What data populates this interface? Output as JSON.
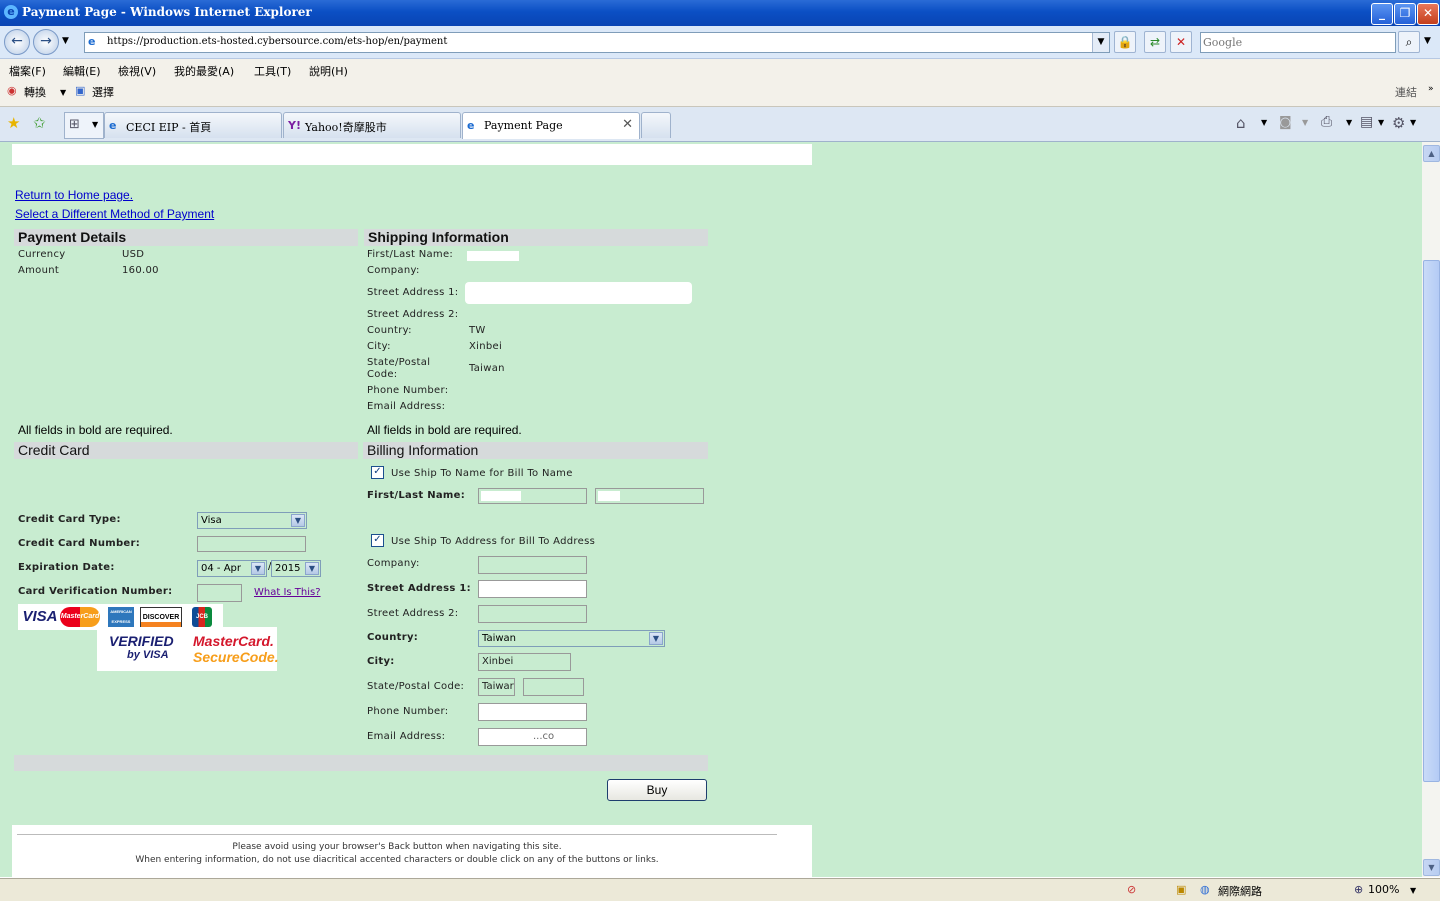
{
  "window": {
    "title": "Payment Page - Windows Internet Explorer"
  },
  "address": {
    "url": "https://production.ets-hosted.cybersource.com/ets-hop/en/payment",
    "search_placeholder": "Google"
  },
  "menu": {
    "file": "檔案(F)",
    "edit": "編輯(E)",
    "view": "檢視(V)",
    "favorites": "我的最愛(A)",
    "tools": "工具(T)",
    "help": "說明(H)"
  },
  "linkbar": {
    "convert": "轉換",
    "select": "選擇",
    "links": "連結"
  },
  "tabs": [
    {
      "label": "CECI EIP - 首頁"
    },
    {
      "label": "Yahoo!奇摩股市"
    },
    {
      "label": "Payment Page"
    }
  ],
  "page": {
    "return_home": "Return to Home page.",
    "different_method": "Select a Different Method of Payment",
    "payment_details": {
      "heading": "Payment Details",
      "currency_label": "Currency",
      "currency_value": "USD",
      "amount_label": "Amount",
      "amount_value": "160.00"
    },
    "shipping": {
      "heading": "Shipping Information",
      "name_label": "First/Last Name:",
      "company_label": "Company:",
      "street1_label": "Street Address 1:",
      "street2_label": "Street Address 2:",
      "country_label": "Country:",
      "country_value": "TW",
      "city_label": "City:",
      "city_value": "Xinbei",
      "state_label_1": "State/Postal",
      "state_label_2": "Code:",
      "state_value": "Taiwan",
      "phone_label": "Phone Number:",
      "email_label": "Email Address:"
    },
    "required_note": "All fields in bold are required.",
    "credit_card": {
      "heading": "Credit Card",
      "type_label": "Credit Card Type:",
      "type_value": "Visa",
      "number_label": "Credit Card Number:",
      "expiration_label": "Expiration Date:",
      "exp_month": "04 - Apr",
      "exp_year": "2015",
      "cvn_label": "Card Verification Number:",
      "what_is_this": "What Is This?",
      "logos": [
        "VISA",
        "MasterCard",
        "AMERICAN EXPRESS",
        "DISCOVER",
        "JCB"
      ],
      "badge_visa_1": "VERIFIED",
      "badge_visa_2": "by VISA",
      "badge_mc_1": "MasterCard.",
      "badge_mc_2": "SecureCode."
    },
    "billing": {
      "heading": "Billing Information",
      "use_ship_name": "Use Ship To Name for Bill To Name",
      "name_label": "First/Last Name:",
      "use_ship_address": "Use Ship To Address for Bill To Address",
      "company_label": "Company:",
      "street1_label": "Street Address 1:",
      "street2_label": "Street Address 2:",
      "country_label": "Country:",
      "country_value": "Taiwan",
      "city_label": "City:",
      "city_value": "Xinbei",
      "state_label": "State/Postal Code:",
      "state_value": "Taiwar",
      "phone_label": "Phone Number:",
      "email_label": "Email Address:",
      "email_partial": "...co"
    },
    "buy_label": "Buy",
    "footer_1": "Please avoid using your browser's Back button when navigating this site.",
    "footer_2": "When entering information, do not use diacritical accented characters or double click on any of the buttons or links."
  },
  "status": {
    "zone": "網際網路",
    "zoom": "100%"
  }
}
